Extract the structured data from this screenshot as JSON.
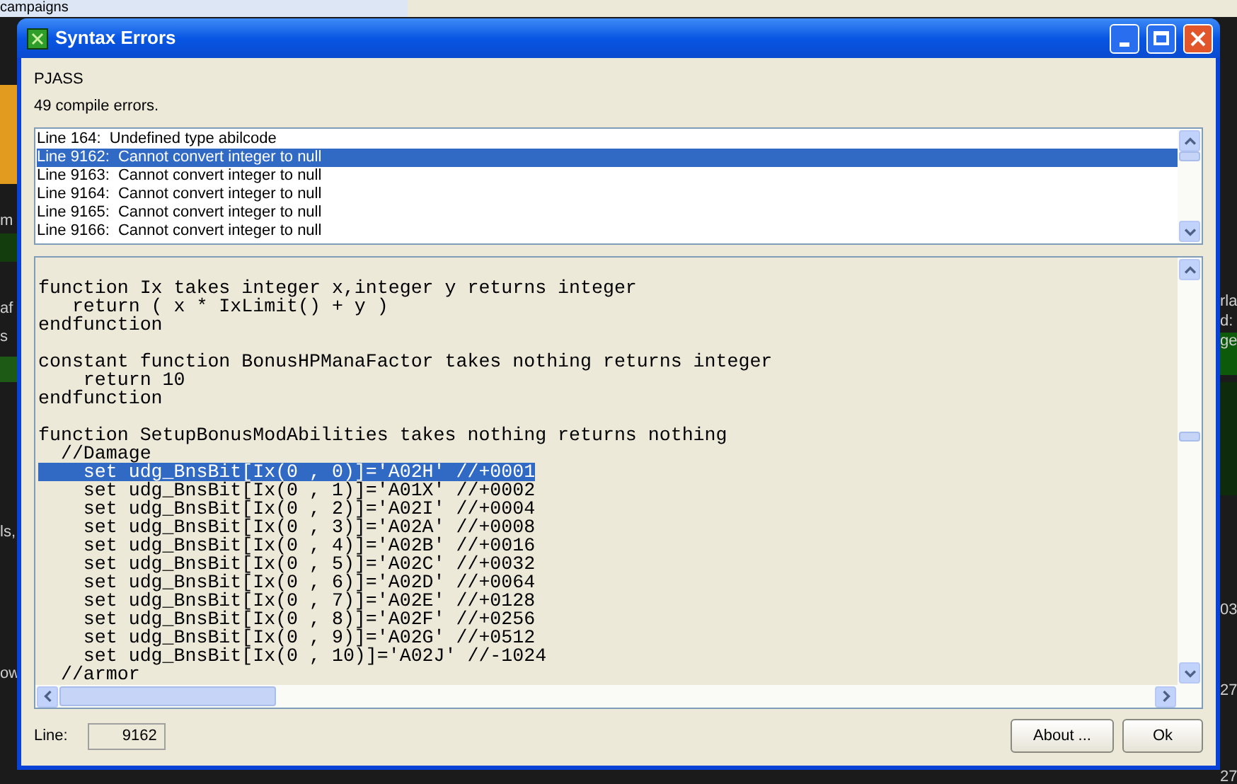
{
  "background": {
    "tab_label": "campaigns",
    "left_fragments": [
      "m",
      "af",
      "s",
      "ls,",
      "ow"
    ],
    "right_fragments": [
      "rla",
      "d:",
      "ge",
      "03",
      "27",
      "27"
    ]
  },
  "window": {
    "title": "Syntax Errors"
  },
  "tool_name": "PJASS",
  "summary": "49 compile errors.",
  "errors": [
    {
      "line": "Line 164:",
      "message": "Undefined type abilcode",
      "selected": false
    },
    {
      "line": "Line 9162:",
      "message": "Cannot convert integer to null",
      "selected": true
    },
    {
      "line": "Line 9163:",
      "message": "Cannot convert integer to null",
      "selected": false
    },
    {
      "line": "Line 9164:",
      "message": "Cannot convert integer to null",
      "selected": false
    },
    {
      "line": "Line 9165:",
      "message": "Cannot convert integer to null",
      "selected": false
    },
    {
      "line": "Line 9166:",
      "message": "Cannot convert integer to null",
      "selected": false
    }
  ],
  "code": [
    {
      "kind": "code",
      "text": "function Ix takes integer x,integer y returns integer",
      "selected": false
    },
    {
      "kind": "code",
      "text": "   return ( x * IxLimit() + y )",
      "selected": false
    },
    {
      "kind": "code",
      "text": "endfunction",
      "selected": false
    },
    {
      "kind": "blank"
    },
    {
      "kind": "code",
      "text": "constant function BonusHPManaFactor takes nothing returns integer",
      "selected": false
    },
    {
      "kind": "code",
      "text": "    return 10",
      "selected": false
    },
    {
      "kind": "code",
      "text": "endfunction",
      "selected": false
    },
    {
      "kind": "blank"
    },
    {
      "kind": "code",
      "text": "function SetupBonusModAbilities takes nothing returns nothing",
      "selected": false
    },
    {
      "kind": "code",
      "text": "  //Damage",
      "selected": false
    },
    {
      "kind": "code",
      "text": "    set udg_BnsBit[Ix(0 , 0)]='A02H' //+0001",
      "selected": true
    },
    {
      "kind": "code",
      "text": "    set udg_BnsBit[Ix(0 , 1)]='A01X' //+0002",
      "selected": false
    },
    {
      "kind": "code",
      "text": "    set udg_BnsBit[Ix(0 , 2)]='A02I' //+0004",
      "selected": false
    },
    {
      "kind": "code",
      "text": "    set udg_BnsBit[Ix(0 , 3)]='A02A' //+0008",
      "selected": false
    },
    {
      "kind": "code",
      "text": "    set udg_BnsBit[Ix(0 , 4)]='A02B' //+0016",
      "selected": false
    },
    {
      "kind": "code",
      "text": "    set udg_BnsBit[Ix(0 , 5)]='A02C' //+0032",
      "selected": false
    },
    {
      "kind": "code",
      "text": "    set udg_BnsBit[Ix(0 , 6)]='A02D' //+0064",
      "selected": false
    },
    {
      "kind": "code",
      "text": "    set udg_BnsBit[Ix(0 , 7)]='A02E' //+0128",
      "selected": false
    },
    {
      "kind": "code",
      "text": "    set udg_BnsBit[Ix(0 , 8)]='A02F' //+0256",
      "selected": false
    },
    {
      "kind": "code",
      "text": "    set udg_BnsBit[Ix(0 , 9)]='A02G' //+0512",
      "selected": false
    },
    {
      "kind": "code",
      "text": "    set udg_BnsBit[Ix(0 , 10)]='A02J' //-1024",
      "selected": false
    },
    {
      "kind": "code",
      "text": "  //armor",
      "selected": false
    }
  ],
  "line_field": {
    "label": "Line:",
    "value": "9162"
  },
  "buttons": [
    "About ...",
    "Ok"
  ]
}
